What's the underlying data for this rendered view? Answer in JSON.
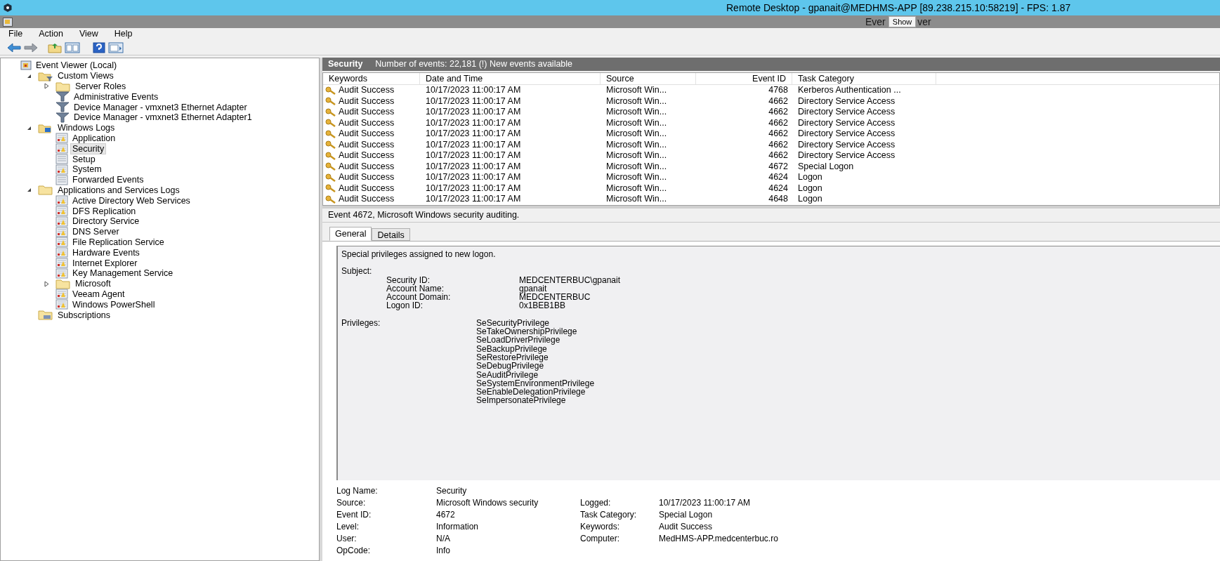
{
  "remote_bar": {
    "title": "Remote Desktop - gpanait@MEDHMS-APP [89.238.215.10:58219] - FPS: 1.87"
  },
  "window": {
    "title_start": "Ever",
    "title_end": "ver",
    "overlay_button": "Show"
  },
  "menu": [
    "File",
    "Action",
    "View",
    "Help"
  ],
  "tree": [
    {
      "label": "Event Viewer (Local)",
      "kind": "root",
      "selected": false,
      "children": [
        {
          "label": "Custom Views",
          "kind": "views",
          "selected": false,
          "expanded": true,
          "children": [
            {
              "label": "Server Roles",
              "kind": "folder",
              "selected": false,
              "expanded": false
            },
            {
              "label": "Administrative Events",
              "kind": "filter",
              "selected": false
            },
            {
              "label": "Device Manager - vmxnet3 Ethernet Adapter",
              "kind": "filter",
              "selected": false
            },
            {
              "label": "Device Manager - vmxnet3 Ethernet Adapter1",
              "kind": "filter",
              "selected": false
            }
          ]
        },
        {
          "label": "Windows Logs",
          "kind": "winlogs",
          "selected": false,
          "expanded": true,
          "children": [
            {
              "label": "Application",
              "kind": "log",
              "selected": false
            },
            {
              "label": "Security",
              "kind": "log",
              "selected": true
            },
            {
              "label": "Setup",
              "kind": "plainlog",
              "selected": false
            },
            {
              "label": "System",
              "kind": "log",
              "selected": false
            },
            {
              "label": "Forwarded Events",
              "kind": "plainlog",
              "selected": false
            }
          ]
        },
        {
          "label": "Applications and Services Logs",
          "kind": "folder",
          "selected": false,
          "expanded": true,
          "children": [
            {
              "label": "Active Directory Web Services",
              "kind": "log",
              "selected": false
            },
            {
              "label": "DFS Replication",
              "kind": "log",
              "selected": false
            },
            {
              "label": "Directory Service",
              "kind": "log",
              "selected": false
            },
            {
              "label": "DNS Server",
              "kind": "log",
              "selected": false
            },
            {
              "label": "File Replication Service",
              "kind": "log",
              "selected": false
            },
            {
              "label": "Hardware Events",
              "kind": "log",
              "selected": false
            },
            {
              "label": "Internet Explorer",
              "kind": "log",
              "selected": false
            },
            {
              "label": "Key Management Service",
              "kind": "log",
              "selected": false
            },
            {
              "label": "Microsoft",
              "kind": "folder",
              "selected": false,
              "expanded": false
            },
            {
              "label": "Veeam Agent",
              "kind": "log",
              "selected": false
            },
            {
              "label": "Windows PowerShell",
              "kind": "log",
              "selected": false
            }
          ]
        },
        {
          "label": "Subscriptions",
          "kind": "subs",
          "selected": false
        }
      ]
    }
  ],
  "log_header": {
    "name": "Security",
    "summary": "Number of events: 22,181 (!) New events available"
  },
  "table": {
    "columns": [
      "Keywords",
      "Date and Time",
      "Source",
      "Event ID",
      "Task Category"
    ],
    "rows": [
      [
        "Audit Success",
        "10/17/2023 11:00:17 AM",
        "Microsoft Win...",
        "4768",
        "Kerberos Authentication ..."
      ],
      [
        "Audit Success",
        "10/17/2023 11:00:17 AM",
        "Microsoft Win...",
        "4662",
        "Directory Service Access"
      ],
      [
        "Audit Success",
        "10/17/2023 11:00:17 AM",
        "Microsoft Win...",
        "4662",
        "Directory Service Access"
      ],
      [
        "Audit Success",
        "10/17/2023 11:00:17 AM",
        "Microsoft Win...",
        "4662",
        "Directory Service Access"
      ],
      [
        "Audit Success",
        "10/17/2023 11:00:17 AM",
        "Microsoft Win...",
        "4662",
        "Directory Service Access"
      ],
      [
        "Audit Success",
        "10/17/2023 11:00:17 AM",
        "Microsoft Win...",
        "4662",
        "Directory Service Access"
      ],
      [
        "Audit Success",
        "10/17/2023 11:00:17 AM",
        "Microsoft Win...",
        "4662",
        "Directory Service Access"
      ],
      [
        "Audit Success",
        "10/17/2023 11:00:17 AM",
        "Microsoft Win...",
        "4672",
        "Special Logon"
      ],
      [
        "Audit Success",
        "10/17/2023 11:00:17 AM",
        "Microsoft Win...",
        "4624",
        "Logon"
      ],
      [
        "Audit Success",
        "10/17/2023 11:00:17 AM",
        "Microsoft Win...",
        "4624",
        "Logon"
      ],
      [
        "Audit Success",
        "10/17/2023 11:00:17 AM",
        "Microsoft Win...",
        "4648",
        "Logon"
      ]
    ]
  },
  "detail": {
    "title": "Event 4672, Microsoft Windows security auditing.",
    "tabs": [
      {
        "label": "General",
        "selected": true
      },
      {
        "label": "Details",
        "selected": false
      }
    ],
    "message": "Special privileges assigned to new logon.",
    "subject_label": "Subject:",
    "subject": [
      {
        "label": "Security ID:",
        "value": "MEDCENTERBUC\\gpanait"
      },
      {
        "label": "Account Name:",
        "value": "gpanait"
      },
      {
        "label": "Account Domain:",
        "value": "MEDCENTERBUC"
      },
      {
        "label": "Logon ID:",
        "value": "0x1BEB1BB"
      }
    ],
    "privileges_label": "Privileges:",
    "privileges": [
      "SeSecurityPrivilege",
      "SeTakeOwnershipPrivilege",
      "SeLoadDriverPrivilege",
      "SeBackupPrivilege",
      "SeRestorePrivilege",
      "SeDebugPrivilege",
      "SeAuditPrivilege",
      "SeSystemEnvironmentPrivilege",
      "SeEnableDelegationPrivilege",
      "SeImpersonatePrivilege"
    ],
    "fields": [
      {
        "left": {
          "label": "Log Name:",
          "value": "Security"
        }
      },
      {
        "left": {
          "label": "Source:",
          "value": "Microsoft Windows security"
        },
        "right": {
          "label": "Logged:",
          "value": "10/17/2023 11:00:17 AM"
        }
      },
      {
        "left": {
          "label": "Event ID:",
          "value": "4672"
        },
        "right": {
          "label": "Task Category:",
          "value": "Special Logon"
        }
      },
      {
        "left": {
          "label": "Level:",
          "value": "Information"
        },
        "right": {
          "label": "Keywords:",
          "value": "Audit Success"
        }
      },
      {
        "left": {
          "label": "User:",
          "value": "N/A"
        },
        "right": {
          "label": "Computer:",
          "value": "MedHMS-APP.medcenterbuc.ro"
        }
      },
      {
        "left": {
          "label": "OpCode:",
          "value": "Info"
        }
      }
    ]
  }
}
